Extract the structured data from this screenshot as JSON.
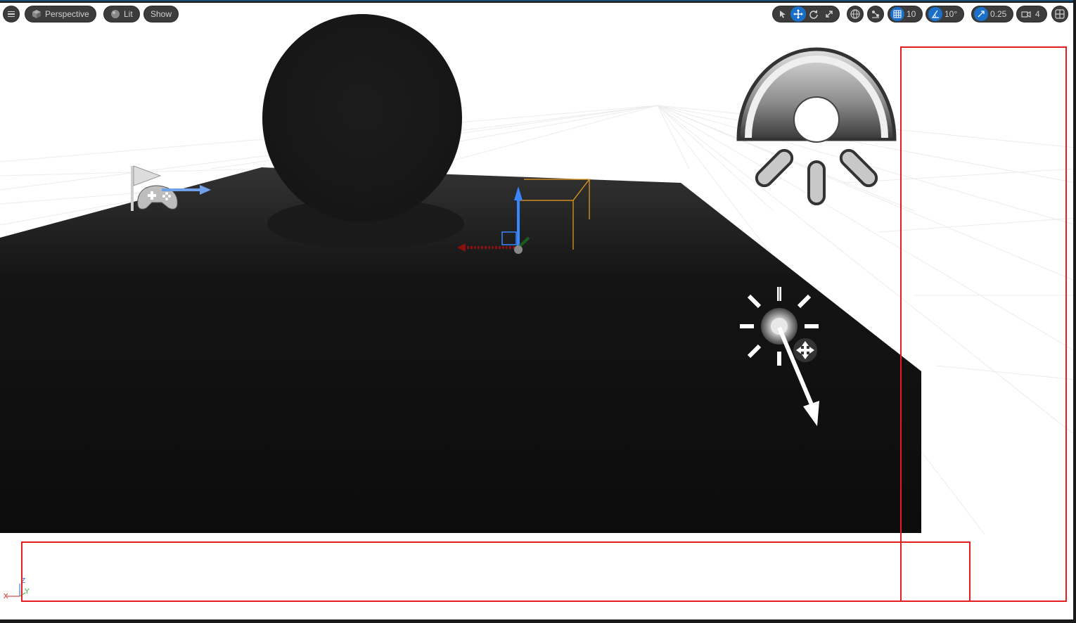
{
  "toolbar": {
    "menu_icon": "hamburger-icon",
    "view_mode": {
      "label": "Perspective",
      "icon": "cube-icon"
    },
    "lighting_mode": {
      "label": "Lit",
      "icon": "sphere-icon"
    },
    "show_label": "Show",
    "transform_tools": [
      "select-icon",
      "translate-icon",
      "rotate-icon",
      "scale-icon"
    ],
    "active_transform_tool": "translate-icon",
    "coordinate_space_icon": "globe-icon",
    "surface_snapping_icon": "surface-snap-icon",
    "grid_snap": {
      "value": "10",
      "icon": "grid-icon",
      "enabled": true
    },
    "rotation_snap": {
      "value": "10°",
      "icon": "angle-icon",
      "enabled": true
    },
    "scale_snap": {
      "value": "0.25",
      "icon": "scale-snap-icon",
      "enabled": true
    },
    "camera_speed": {
      "value": "4",
      "icon": "camera-icon"
    },
    "layout_icon": "viewport-layout-icon"
  },
  "axis_indicator": {
    "x": "X",
    "y": "Y",
    "z": "Z"
  },
  "colors": {
    "accent": "#1b6fc8",
    "highlight_red": "#e31e1e",
    "toolbar_bg": "#3c3c3c",
    "x_axis": "#d01c1c",
    "y_axis": "#28b428",
    "z_axis": "#2a5fd9",
    "selection": "#f0a020"
  },
  "scene_icons": [
    "player-start-flag-icon",
    "gamepad-icon",
    "sky-light-icon",
    "directional-light-icon",
    "translate-gizmo-icon"
  ]
}
